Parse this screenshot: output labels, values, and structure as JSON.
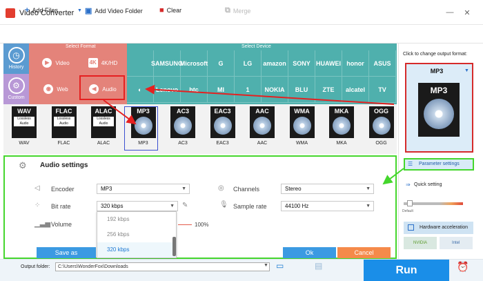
{
  "window": {
    "title": "Video Converter",
    "minimize": "—",
    "close": "✕"
  },
  "toolbar": {
    "add_files": "Add Files",
    "add_video_folder": "Add Video Folder",
    "clear": "Clear",
    "merge": "Merge"
  },
  "nav": {
    "history": "History",
    "custom": "Custom"
  },
  "sections": {
    "select_format": "Select Format",
    "select_device": "Select Device"
  },
  "format_categories": [
    "Video",
    "4K/HD",
    "Web",
    "Audio"
  ],
  "devices_row1": [
    "",
    "SAMSUNG",
    "Microsoft",
    "G",
    "LG",
    "amazon",
    "SONY",
    "HUAWEI",
    "honor",
    "ASUS"
  ],
  "devices_row2": [
    "",
    "Lenovo",
    "htc",
    "MI",
    "1",
    "NOKIA",
    "BLU",
    "ZTE",
    "alcatel",
    "TV"
  ],
  "formats": [
    {
      "name": "WAV",
      "sub": "Lossless Audio",
      "label": "WAV"
    },
    {
      "name": "FLAC",
      "sub": "Lossless Audio",
      "label": "FLAC"
    },
    {
      "name": "ALAC",
      "sub": "Lossless Audio",
      "label": "ALAC"
    },
    {
      "name": "MP3",
      "sub": "",
      "label": "MP3"
    },
    {
      "name": "AC3",
      "sub": "",
      "label": "AC3"
    },
    {
      "name": "EAC3",
      "sub": "",
      "label": "EAC3"
    },
    {
      "name": "AAC",
      "sub": "",
      "label": "AAC"
    },
    {
      "name": "WMA",
      "sub": "",
      "label": "WMA"
    },
    {
      "name": "MKA",
      "sub": "",
      "label": "MKA"
    },
    {
      "name": "OGG",
      "sub": "",
      "label": "OGG"
    }
  ],
  "audio_settings": {
    "title": "Audio settings",
    "encoder_label": "Encoder",
    "encoder_value": "MP3",
    "bitrate_label": "Bit rate",
    "bitrate_value": "320 kbps",
    "volume_label": "Volume",
    "volume_value": "100%",
    "channels_label": "Channels",
    "channels_value": "Stereo",
    "samplerate_label": "Sample rate",
    "samplerate_value": "44100 Hz",
    "bitrate_options": [
      "192 kbps",
      "256 kbps",
      "320 kbps"
    ],
    "save_as": "Save as",
    "ok": "Ok",
    "cancel": "Cancel"
  },
  "bottom": {
    "output_folder_label": "Output folder:",
    "output_folder_value": "C:\\Users\\WonderFox\\Downloads",
    "run": "Run"
  },
  "right_panel": {
    "hint": "Click to change output format:",
    "format": "MP3",
    "icon_text": "MP3",
    "parameter_settings": "Parameter settings",
    "quick_setting": "Quick setting",
    "default": "Default",
    "hw_accel": "Hardware acceleration",
    "nvidia": "NVIDIA",
    "intel": "Intel"
  },
  "colors": {
    "format_panel": "#e4837a",
    "device_panel": "#4fb0ad",
    "highlight_green": "#44d62c",
    "highlight_red": "#e52020",
    "run_blue": "#1a8ee8"
  }
}
